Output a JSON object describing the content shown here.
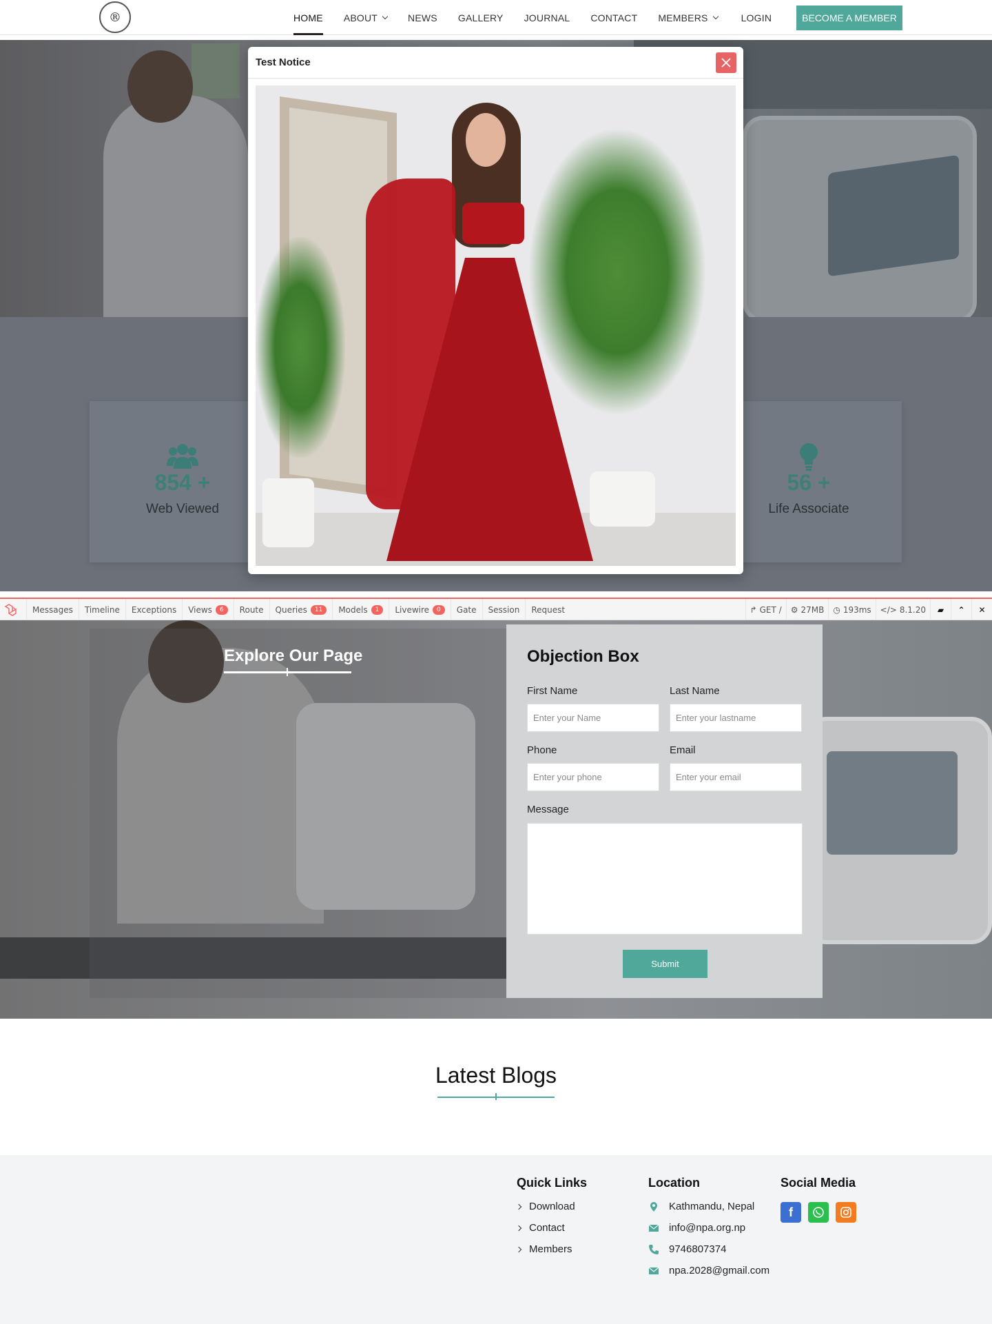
{
  "nav": {
    "logo_text": "®",
    "items": [
      {
        "label": "HOME",
        "dropdown": false,
        "active": true
      },
      {
        "label": "ABOUT",
        "dropdown": true,
        "active": false
      },
      {
        "label": "NEWS",
        "dropdown": false,
        "active": false
      },
      {
        "label": "GALLERY",
        "dropdown": false,
        "active": false
      },
      {
        "label": "JOURNAL",
        "dropdown": false,
        "active": false
      },
      {
        "label": "CONTACT",
        "dropdown": false,
        "active": false
      },
      {
        "label": "MEMBERS",
        "dropdown": true,
        "active": false
      },
      {
        "label": "LOGIN",
        "dropdown": false,
        "active": false
      }
    ],
    "cta": "BECOME A MEMBER"
  },
  "modal": {
    "title": "Test Notice",
    "close_icon": "close-icon"
  },
  "stats": [
    {
      "value": "854 +",
      "label": "Web Viewed",
      "icon": "users-icon"
    },
    {
      "value": "56 +",
      "label": "Life Associate",
      "icon": "lightbulb-icon"
    }
  ],
  "debugbar": {
    "tabs": [
      {
        "label": "Messages",
        "badge": ""
      },
      {
        "label": "Timeline",
        "badge": ""
      },
      {
        "label": "Exceptions",
        "badge": ""
      },
      {
        "label": "Views",
        "badge": "6"
      },
      {
        "label": "Route",
        "badge": ""
      },
      {
        "label": "Queries",
        "badge": "11"
      },
      {
        "label": "Models",
        "badge": "1"
      },
      {
        "label": "Livewire",
        "badge": "0"
      },
      {
        "label": "Gate",
        "badge": ""
      },
      {
        "label": "Session",
        "badge": ""
      },
      {
        "label": "Request",
        "badge": ""
      }
    ],
    "method": "GET /",
    "memory": "27MB",
    "time": "193ms",
    "version": "8.1.20"
  },
  "contact": {
    "explore": "Explore Our Page",
    "form_title": "Objection Box",
    "first_name_label": "First Name",
    "first_name_placeholder": "Enter your Name",
    "last_name_label": "Last Name",
    "last_name_placeholder": "Enter your lastname",
    "phone_label": "Phone",
    "phone_placeholder": "Enter your phone",
    "email_label": "Email",
    "email_placeholder": "Enter your email",
    "message_label": "Message",
    "submit": "Submit"
  },
  "blogs": {
    "title": "Latest Blogs"
  },
  "footer": {
    "quick_links_title": "Quick Links",
    "quick_links": [
      "Download",
      "Contact",
      "Members"
    ],
    "location_title": "Location",
    "location_items": [
      {
        "icon": "map-pin-icon",
        "text": "Kathmandu, Nepal"
      },
      {
        "icon": "mail-icon",
        "text": "info@npa.org.np"
      },
      {
        "icon": "phone-icon",
        "text": "9746807374"
      },
      {
        "icon": "mail-icon",
        "text": "npa.2028@gmail.com"
      }
    ],
    "social_title": "Social Media",
    "social": [
      {
        "icon": "facebook-icon",
        "color": "#3b6fd1"
      },
      {
        "icon": "whatsapp-icon",
        "color": "#2bbf4e"
      },
      {
        "icon": "instagram-icon",
        "color": "#f47c20"
      }
    ]
  },
  "colors": {
    "accent": "#4fa89a",
    "debug_red": "#f4645f",
    "close_red": "#e66465"
  }
}
